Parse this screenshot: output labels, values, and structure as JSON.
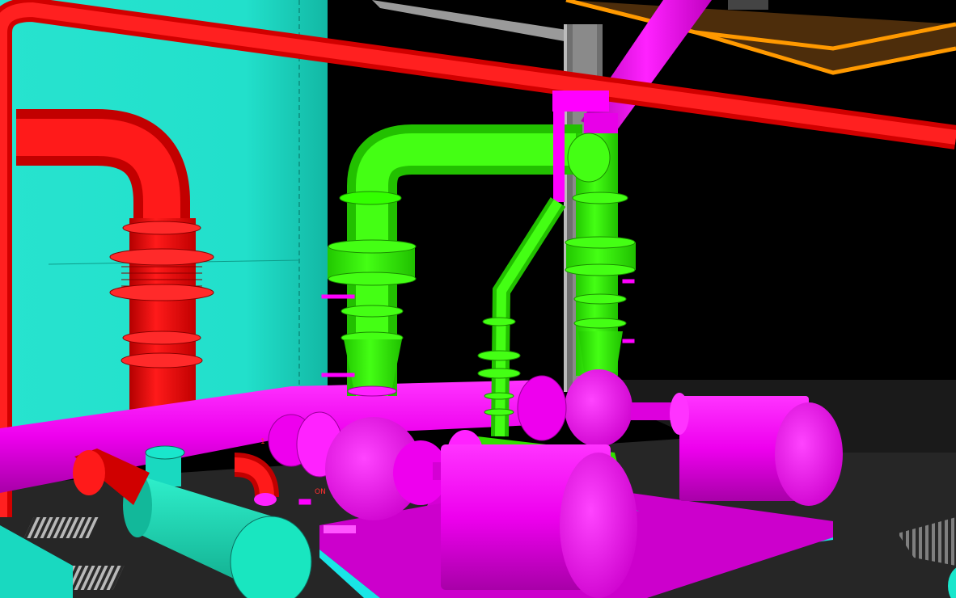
{
  "scene": {
    "background": "#000000",
    "colors": {
      "vessel": "#1fd9c4",
      "red_pipe": "#ff0000",
      "green_pipe": "#33ff00",
      "magenta_pipe": "#ff00ff",
      "cyan_pipe": "#19e6c0",
      "orange_tray": "#ff9900",
      "tray_fill": "#4d2d0b",
      "column": "#7c7c7c",
      "floor": "#2a2a2a",
      "floor_light": "#bdbdbd"
    },
    "tags": [
      "1",
      "ON"
    ]
  }
}
